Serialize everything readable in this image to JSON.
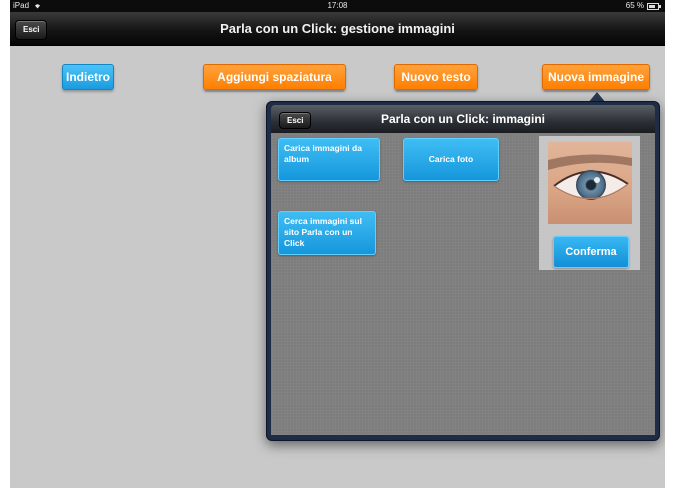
{
  "status_bar": {
    "carrier": "iPad",
    "time": "17:08",
    "battery": "65 %"
  },
  "nav_bar": {
    "title": "Parla con un Click: gestione immagini",
    "exit_label": "Esci"
  },
  "toolbar": {
    "back_label": "Indietro",
    "add_spacing_label": "Aggiungi spaziatura",
    "new_text_label": "Nuovo testo",
    "new_image_label": "Nuova immagine"
  },
  "popover": {
    "title": "Parla con un Click: immagini",
    "exit_label": "Esci",
    "load_album_label": "Carica immagini da album",
    "load_photo_label": "Carica foto",
    "search_site_label": "Cerca immagini sul sito Parla con un Click",
    "confirm_label": "Conferma"
  },
  "colors": {
    "blue_button": "#1a9be0",
    "orange_button": "#ff7f00",
    "background": "#c9c9c9",
    "popover_body": "#7d7d7d",
    "popover_border": "#1e2c46"
  }
}
